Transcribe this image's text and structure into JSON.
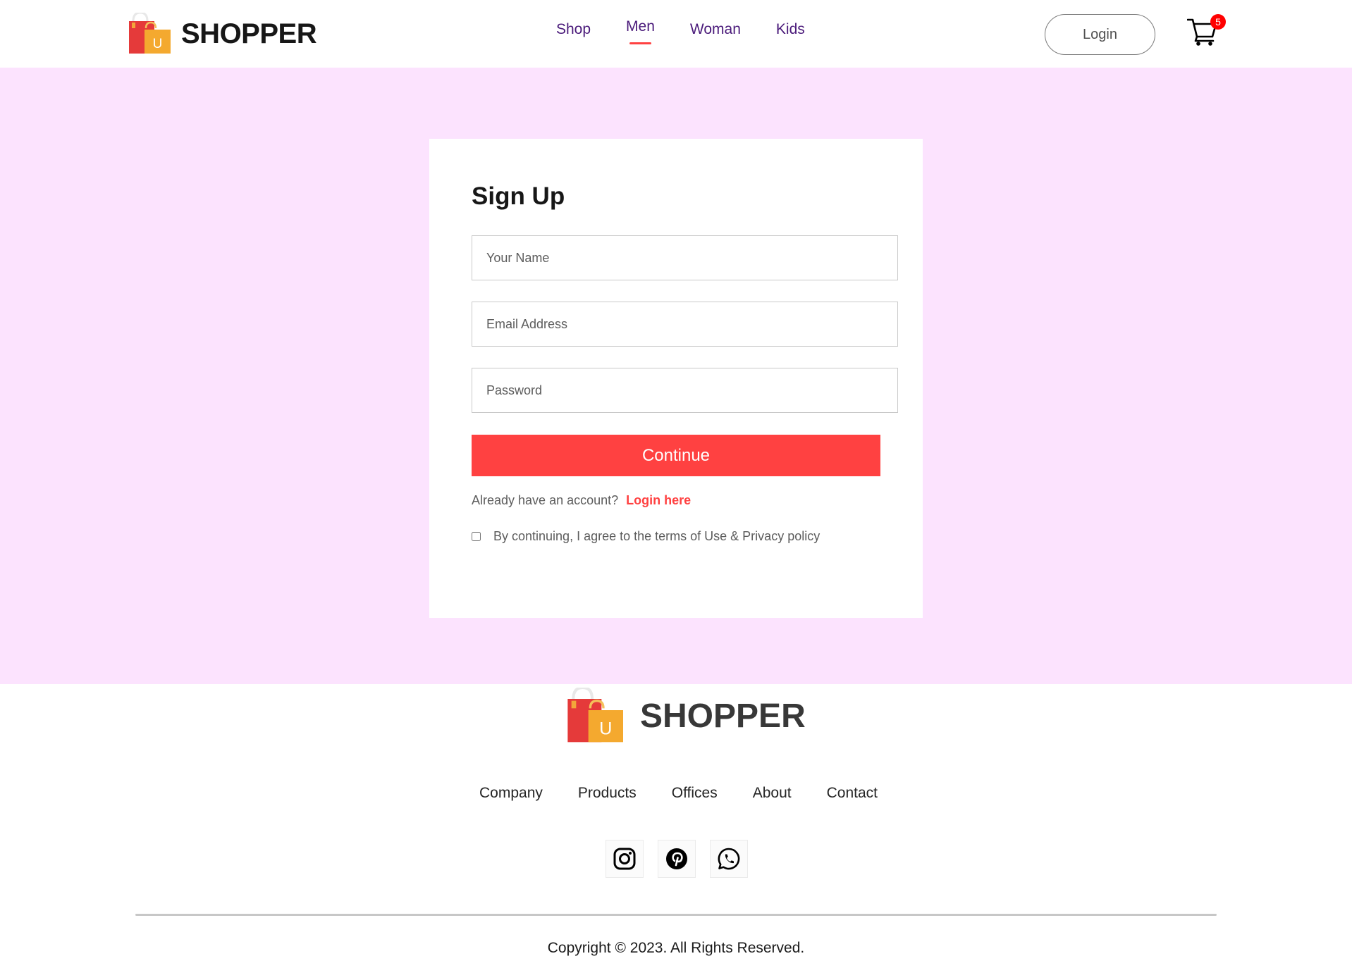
{
  "brand": {
    "name": "SHOPPER",
    "bag_letter": "U"
  },
  "nav": {
    "items": [
      {
        "label": "Shop",
        "active": false
      },
      {
        "label": "Men",
        "active": true
      },
      {
        "label": "Woman",
        "active": false
      },
      {
        "label": "Kids",
        "active": false
      }
    ],
    "login_label": "Login",
    "cart_count": "5"
  },
  "signup": {
    "title": "Sign Up",
    "name_placeholder": "Your Name",
    "email_placeholder": "Email Address",
    "password_placeholder": "Password",
    "continue_label": "Continue",
    "login_prompt": "Already have an account?",
    "login_link": "Login here",
    "agree_text": "By continuing, I agree to the terms of Use & Privacy policy",
    "agree_checked": false
  },
  "footer": {
    "links": [
      "Company",
      "Products",
      "Offices",
      "About",
      "Contact"
    ],
    "social": [
      "instagram-icon",
      "pinterest-icon",
      "whatsapp-icon"
    ],
    "copyright": "Copyright © 2023. All Rights Reserved."
  },
  "colors": {
    "accent": "#ff4141",
    "section_bg": "#fce3fe",
    "nav_text": "#4a1a7a",
    "badge": "#ff0000"
  }
}
